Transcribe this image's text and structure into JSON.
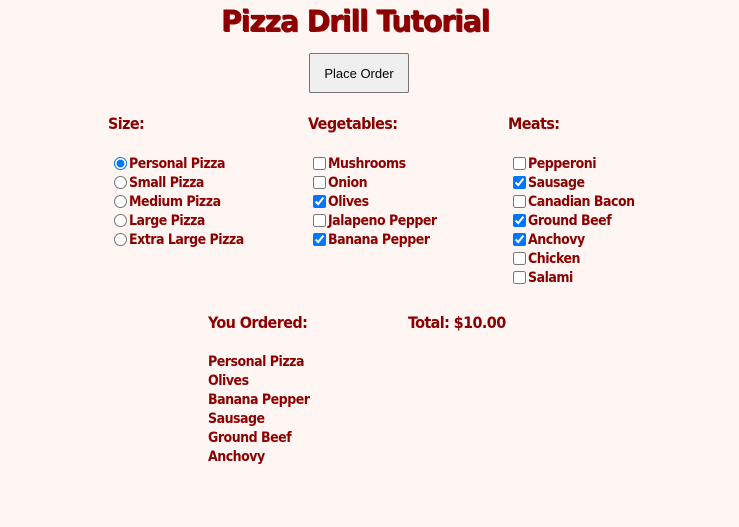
{
  "page": {
    "title": "Pizza Drill Tutorial",
    "place_order_label": "Place Order"
  },
  "size": {
    "header": "Size:",
    "options": [
      {
        "label": "Personal Pizza",
        "selected": true
      },
      {
        "label": "Small Pizza",
        "selected": false
      },
      {
        "label": "Medium Pizza",
        "selected": false
      },
      {
        "label": "Large Pizza",
        "selected": false
      },
      {
        "label": "Extra Large Pizza",
        "selected": false
      }
    ]
  },
  "vegetables": {
    "header": "Vegetables:",
    "options": [
      {
        "label": "Mushrooms",
        "checked": false
      },
      {
        "label": "Onion",
        "checked": false
      },
      {
        "label": "Olives",
        "checked": true
      },
      {
        "label": "Jalapeno Pepper",
        "checked": false
      },
      {
        "label": "Banana Pepper",
        "checked": true
      }
    ]
  },
  "meats": {
    "header": "Meats:",
    "options": [
      {
        "label": "Pepperoni",
        "checked": false
      },
      {
        "label": "Sausage",
        "checked": true
      },
      {
        "label": "Canadian Bacon",
        "checked": false
      },
      {
        "label": "Ground Beef",
        "checked": true
      },
      {
        "label": "Anchovy",
        "checked": true
      },
      {
        "label": "Chicken",
        "checked": false
      },
      {
        "label": "Salami",
        "checked": false
      }
    ]
  },
  "summary": {
    "ordered_header": "You Ordered:",
    "total_text": "Total: $10.00",
    "items": [
      "Personal Pizza",
      "Olives",
      "Banana Pepper",
      "Sausage",
      "Ground Beef",
      "Anchovy"
    ]
  },
  "colors": {
    "text": "#8b0000",
    "background": "#fff5f2",
    "accent": "#0075ff"
  }
}
